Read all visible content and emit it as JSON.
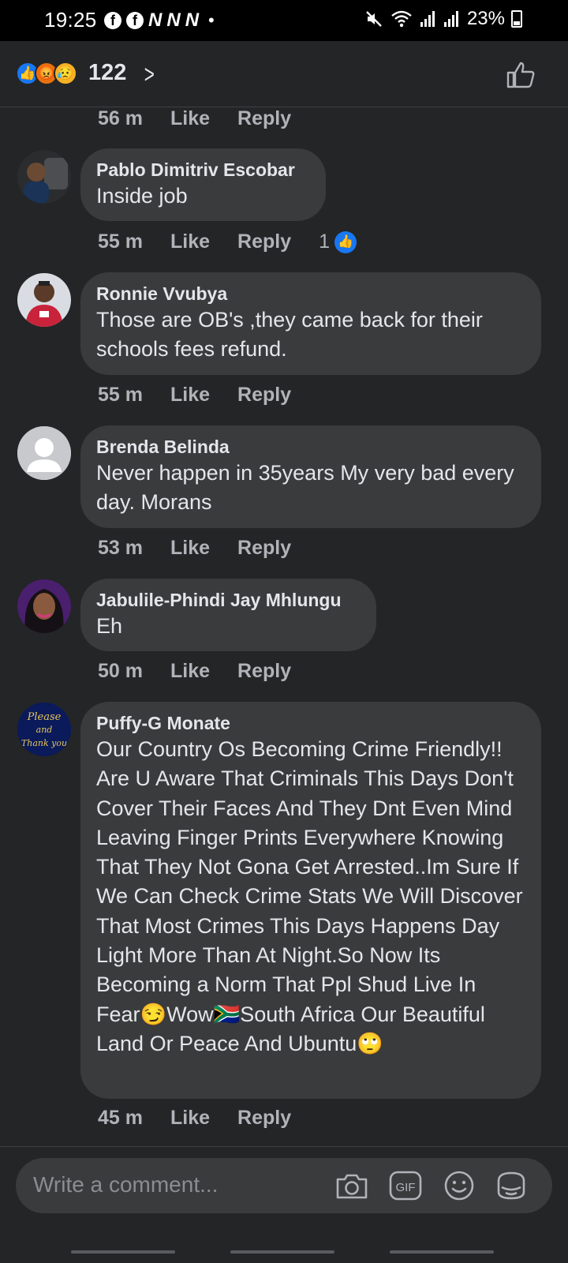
{
  "status_bar": {
    "time": "19:25",
    "battery": "23%",
    "app_letters": [
      "N",
      "N",
      "N"
    ]
  },
  "reactions": {
    "count": "122",
    "icons": [
      "like-reaction-icon",
      "angry-reaction-icon",
      "sad-reaction-icon"
    ]
  },
  "comments": [
    {
      "author": "",
      "text": "",
      "time": "56 m",
      "like": "Like",
      "reply": "Reply",
      "likes": ""
    },
    {
      "author": "Pablo Dimitriv Escobar",
      "text": "Inside job",
      "time": "55 m",
      "like": "Like",
      "reply": "Reply",
      "likes": "1"
    },
    {
      "author": "Ronnie Vvubya",
      "text": "Those are OB's ,they came back for their schools fees refund.",
      "time": "55 m",
      "like": "Like",
      "reply": "Reply",
      "likes": ""
    },
    {
      "author": "Brenda Belinda",
      "text": "Never happen in 35years  My very bad every day. Morans",
      "time": "53 m",
      "like": "Like",
      "reply": "Reply",
      "likes": ""
    },
    {
      "author": "Jabulile-Phindi Jay Mhlungu",
      "text": "Eh",
      "time": "50 m",
      "like": "Like",
      "reply": "Reply",
      "likes": ""
    },
    {
      "author": "Puffy-G Monate",
      "text": "Our Country Os Becoming Crime Friendly!! Are U Aware That Criminals This Days Don't Cover Their Faces And They Dnt Even Mind Leaving Finger Prints Everywhere Knowing That They Not Gona Get Arrested..Im Sure If We Can Check Crime Stats We Will Discover That Most Crimes This Days Happens Day Light More Than At Night.So Now Its Becoming a Norm That Ppl Shud Live In Fear😏Wow🇿🇦South Africa Our Beautiful Land Or Peace And Ubuntu🙄",
      "time": "45 m",
      "like": "Like",
      "reply": "Reply",
      "likes": ""
    }
  ],
  "avatar_text": {
    "puffy": [
      "Please",
      "and",
      "Thank you"
    ]
  },
  "composer": {
    "placeholder": "Write a comment...",
    "gif_label": "GIF"
  },
  "colors": {
    "background": "#242526",
    "bubble": "#3a3b3c",
    "accent": "#1877f2",
    "secondary_text": "#b0b3b8"
  }
}
